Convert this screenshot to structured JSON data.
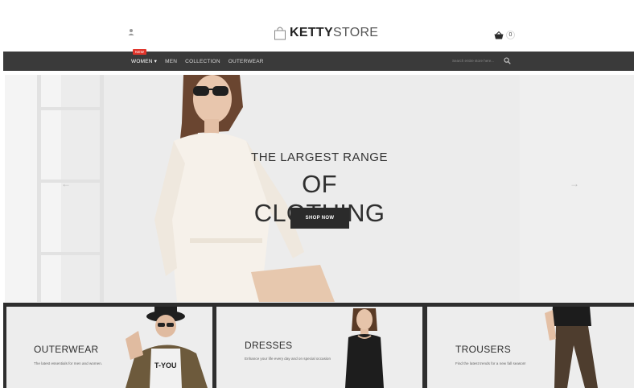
{
  "header": {
    "logo_bold": "KETTY",
    "logo_light": "STORE",
    "cart_count": "0"
  },
  "nav": {
    "items": [
      {
        "label": "WOMEN",
        "badge": "new"
      },
      {
        "label": "MEN"
      },
      {
        "label": "COLLECTION"
      },
      {
        "label": "OUTERWEAR"
      }
    ],
    "search_placeholder": "Search entire store here..."
  },
  "hero": {
    "title_line1": "THE LARGEST RANGE",
    "title_line2": "OF CLOTHING",
    "button_label": "SHOP NOW"
  },
  "categories": [
    {
      "title": "OUTERWEAR",
      "description": "The latest essentials for men and women."
    },
    {
      "title": "DRESSES",
      "description": "Enhance your life every day and on special occasion"
    },
    {
      "title": "TROUSERS",
      "description": "Find the latest trends for a new fall season!"
    }
  ],
  "colors": {
    "nav_bg": "#3a3a3a",
    "badge": "#e0352b",
    "button": "#2b2b2b",
    "hero_bg": "#ececec"
  }
}
